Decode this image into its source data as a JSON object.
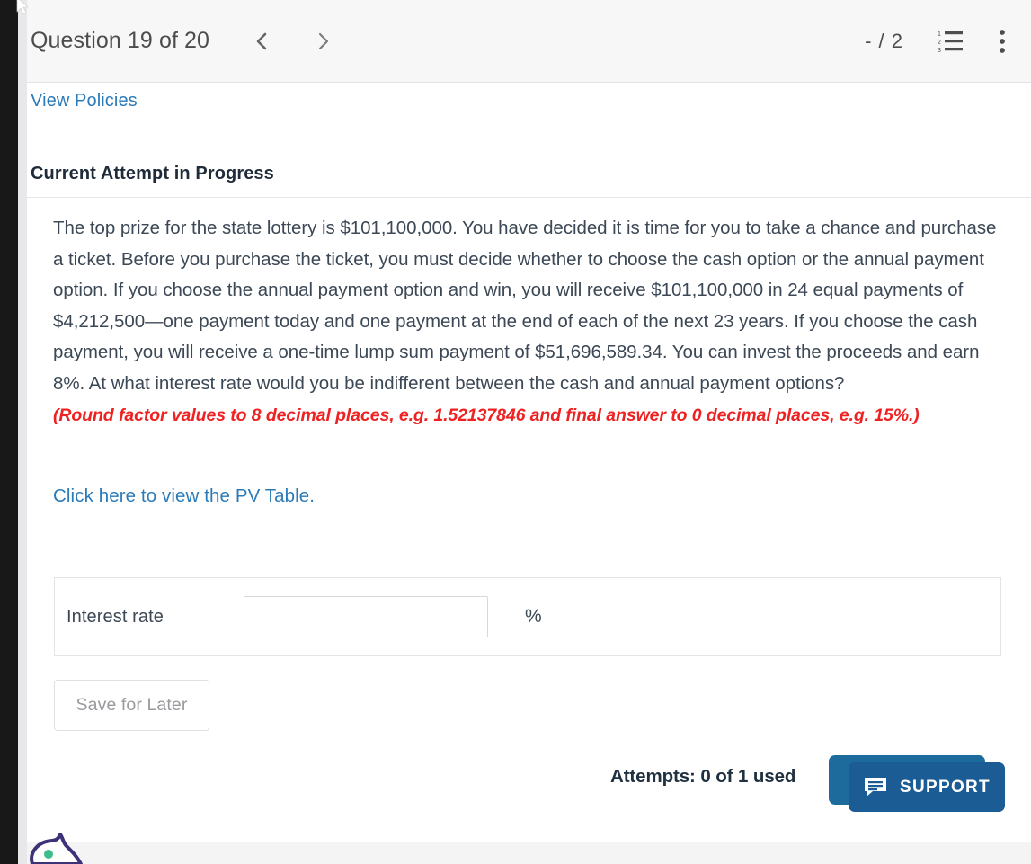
{
  "header": {
    "question_title": "Question 19 of 20",
    "prev_icon": "chevron-left-icon",
    "next_icon": "chevron-right-icon",
    "score": "- / 2",
    "list_icon": "numbered-list-icon",
    "menu_icon": "more-vertical-icon"
  },
  "content": {
    "view_policies_link": "View Policies",
    "attempt_heading": "Current Attempt in Progress",
    "question_text": "The top prize for the state lottery is $101,100,000. You have decided it is time for you to take a chance and purchase a ticket. Before you purchase the ticket, you must decide whether to choose the cash option or the annual payment option. If you choose the annual payment option and win, you will receive $101,100,000 in 24 equal payments of $4,212,500—one payment today and one payment at the end of each of the next 23 years. If you choose the cash payment, you will receive a one-time lump sum payment of $51,696,589.34. You can invest the proceeds and earn 8%. At what interest rate would you be indifferent between the cash and annual payment options?",
    "question_note": "(Round factor values to 8 decimal places, e.g. 1.52137846 and final answer to 0 decimal places, e.g. 15%.)",
    "pv_table_link": "Click here to view the PV Table."
  },
  "answer": {
    "label": "Interest rate",
    "value": "",
    "placeholder": "",
    "unit": "%"
  },
  "actions": {
    "save_label": "Save for Later",
    "attempts_text": "Attempts: 0 of 1 used"
  },
  "support": {
    "label": "SUPPORT",
    "chat_icon": "chat-bubble-icon",
    "mascot_icon": "chat-mascot-icon"
  },
  "colors": {
    "link": "#2b7bb9",
    "note_red": "#ee2222",
    "support_front": "#1a5c93",
    "support_back": "#1c6b9c",
    "heading": "#1f2b38",
    "body_text": "#3c4855"
  }
}
